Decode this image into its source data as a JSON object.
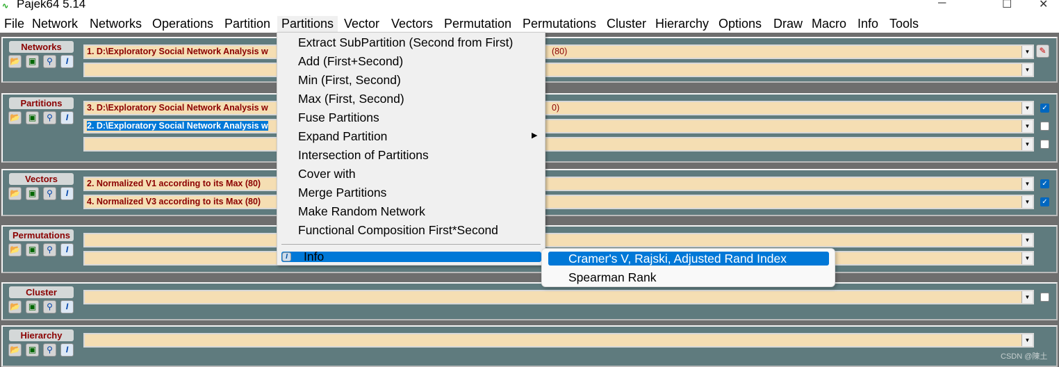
{
  "window": {
    "title": "Pajek64 5.14",
    "minimize": "─",
    "maximize": "☐",
    "close": "✕"
  },
  "menubar": [
    "File",
    "Network",
    "Networks",
    "Operations",
    "Partition",
    "Partitions",
    "Vector",
    "Vectors",
    "Permutation",
    "Permutations",
    "Cluster",
    "Hierarchy",
    "Options",
    "Draw",
    "Macro",
    "Info",
    "Tools"
  ],
  "panels": [
    {
      "label": "Networks",
      "rows": [
        {
          "text": "1. D:\\Exploratory Social Network Analysis w",
          "tail": "(80)"
        },
        {
          "text": ""
        }
      ],
      "side": "pencil"
    },
    {
      "label": "Partitions",
      "rows": [
        {
          "text": "3. D:\\Exploratory Social Network Analysis w",
          "tail": "0)",
          "checked": true
        },
        {
          "text": "2. D:\\Exploratory Social Network Analysis w",
          "selected": true,
          "checked": false
        },
        {
          "text": "",
          "checked": false
        }
      ]
    },
    {
      "label": "Vectors",
      "rows": [
        {
          "text": "2. Normalized V1 according to its Max (80)",
          "checked": true
        },
        {
          "text": "4. Normalized V3 according to its Max (80)",
          "checked": true
        }
      ]
    },
    {
      "label": "Permutations",
      "rows": [
        {
          "text": ""
        },
        {
          "text": ""
        }
      ]
    },
    {
      "label": "Cluster",
      "rows": [
        {
          "text": "",
          "checked": false
        }
      ]
    },
    {
      "label": "Hierarchy",
      "rows": [
        {
          "text": ""
        }
      ]
    }
  ],
  "partitions_menu": {
    "items": [
      "Extract SubPartition (Second from First)",
      "Add (First+Second)",
      "Min (First, Second)",
      "Max (First, Second)",
      "Fuse Partitions",
      "Expand Partition",
      "Intersection of Partitions",
      "Cover with",
      "Merge Partitions",
      "Make Random Network",
      "Functional Composition First*Second"
    ],
    "info": "Info"
  },
  "info_submenu": [
    "Cramer's V, Rajski, Adjusted Rand Index",
    "Spearman Rank"
  ],
  "watermark": "CSDN @陳土",
  "colors": {
    "panel": "#5f7b7e",
    "combo": "#f5deb3",
    "label_text": "#8b0000",
    "highlight": "#0078d7"
  }
}
